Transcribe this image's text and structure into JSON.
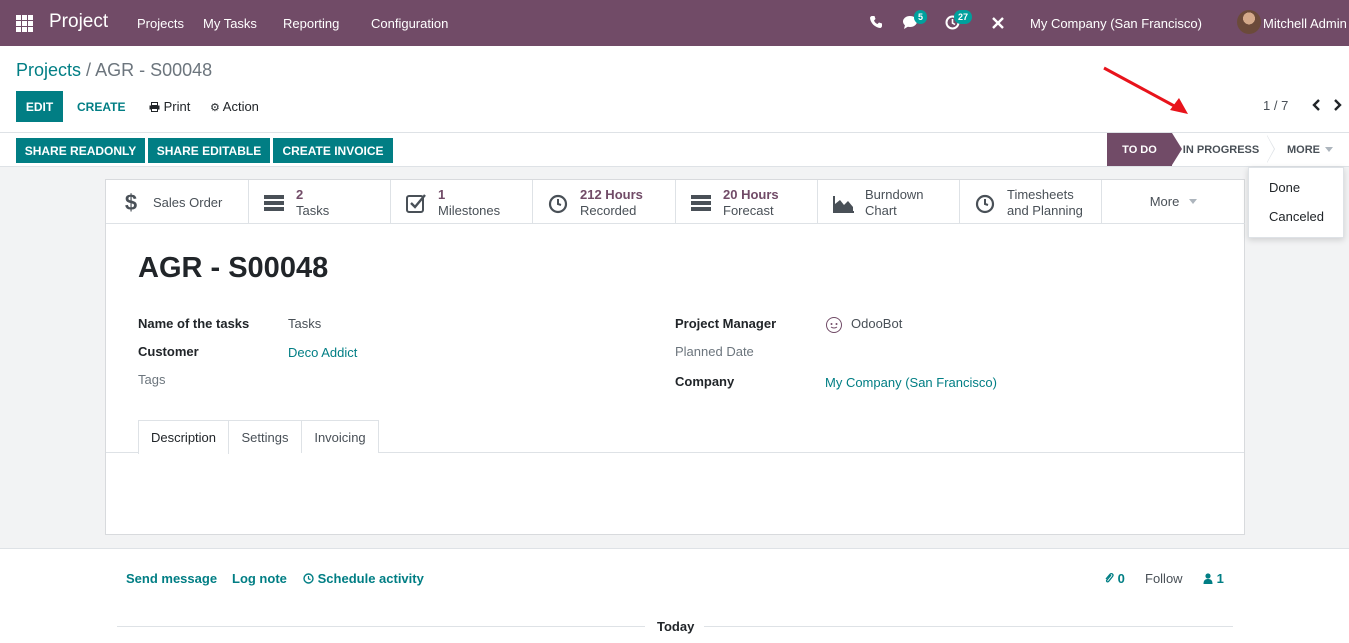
{
  "navbar": {
    "brand": "Project",
    "menus": [
      "Projects",
      "My Tasks",
      "Reporting",
      "Configuration"
    ],
    "messages_count": "5",
    "activities_count": "27",
    "company": "My Company (San Francisco)",
    "user": "Mitchell Admin"
  },
  "breadcrumb": {
    "parent": "Projects",
    "separator": "/",
    "current": "AGR - S00048"
  },
  "control": {
    "edit": "EDIT",
    "create": "CREATE",
    "print": "Print",
    "action": "Action",
    "pager": "1 / 7"
  },
  "statusbar": {
    "buttons": [
      "SHARE READONLY",
      "SHARE EDITABLE",
      "CREATE INVOICE"
    ],
    "stages": [
      "TO DO",
      "IN PROGRESS"
    ],
    "more": "MORE",
    "dropdown": [
      "Done",
      "Canceled"
    ]
  },
  "smart_buttons": {
    "sales_order": "Sales Order",
    "tasks_value": "2",
    "tasks_label": "Tasks",
    "milestones_value": "1",
    "milestones_label": "Milestones",
    "recorded_value": "212 Hours",
    "recorded_label": "Recorded",
    "forecast_value": "20 Hours",
    "forecast_label": "Forecast",
    "burndown_1": "Burndown",
    "burndown_2": "Chart",
    "timesheets_1": "Timesheets",
    "timesheets_2": "and Planning",
    "more": "More"
  },
  "form": {
    "title": "AGR - S00048",
    "name_of_tasks_label": "Name of the tasks",
    "name_of_tasks_value": "Tasks",
    "customer_label": "Customer",
    "customer_value": "Deco Addict",
    "tags_label": "Tags",
    "project_manager_label": "Project Manager",
    "project_manager_value": "OdooBot",
    "planned_date_label": "Planned Date",
    "company_label": "Company",
    "company_value": "My Company (San Francisco)"
  },
  "tabs": [
    "Description",
    "Settings",
    "Invoicing"
  ],
  "chatter": {
    "send_message": "Send message",
    "log_note": "Log note",
    "schedule_activity": "Schedule activity",
    "attachments": "0",
    "follow": "Follow",
    "followers": "1",
    "today": "Today"
  },
  "colors": {
    "brand": "#714b67",
    "accent": "#017e84",
    "badge": "#00a09d",
    "annotation_arrow": "#e8131b"
  }
}
